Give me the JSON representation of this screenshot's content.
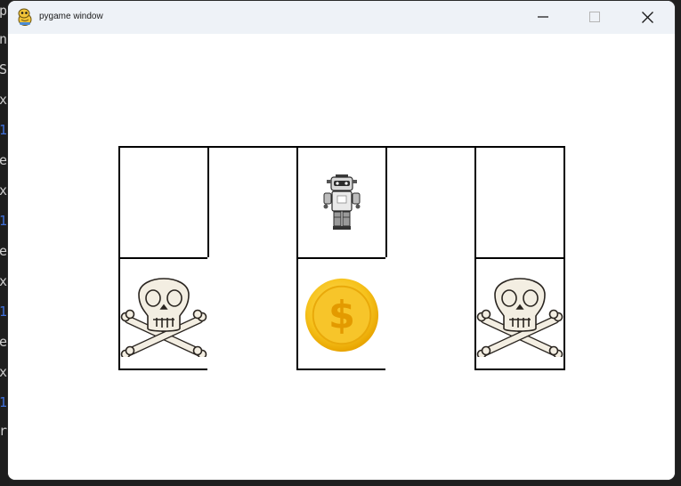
{
  "window": {
    "title": "pygame window"
  },
  "background_editor_glyphs": [
    "p",
    "n",
    "S",
    "x",
    "1",
    "e",
    "x",
    "1",
    "e",
    "x",
    "1",
    "e",
    "x",
    "1",
    "r"
  ],
  "board": {
    "rows": 2,
    "columns": 5,
    "grid_color": "#000000",
    "cells": [
      {
        "row": 0,
        "col": 0,
        "content": "empty"
      },
      {
        "row": 0,
        "col": 1,
        "content": "empty"
      },
      {
        "row": 0,
        "col": 2,
        "content": "robot"
      },
      {
        "row": 0,
        "col": 3,
        "content": "empty"
      },
      {
        "row": 0,
        "col": 4,
        "content": "empty"
      },
      {
        "row": 1,
        "col": 0,
        "content": "skull-and-crossbones"
      },
      {
        "row": 1,
        "col": 1,
        "content": "none"
      },
      {
        "row": 1,
        "col": 2,
        "content": "gold-coin"
      },
      {
        "row": 1,
        "col": 3,
        "content": "none"
      },
      {
        "row": 1,
        "col": 4,
        "content": "skull-and-crossbones"
      }
    ]
  },
  "icons": {
    "app": "pygame-snake-icon",
    "minimize": "minimize-icon",
    "maximize": "maximize-icon",
    "close": "close-icon",
    "coin_symbol": "$"
  },
  "colors": {
    "titlebar": "#eef2f7",
    "coin": "#f5b800",
    "skull": "#f3eee2"
  }
}
